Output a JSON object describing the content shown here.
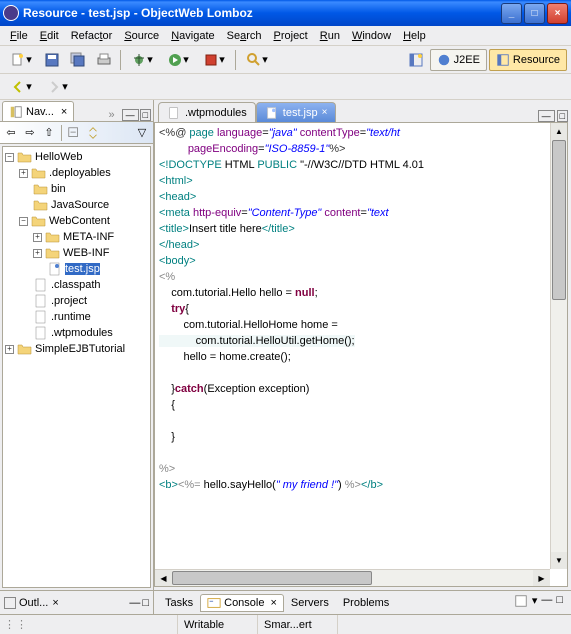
{
  "window": {
    "title": "Resource - test.jsp - ObjectWeb Lomboz"
  },
  "menu": {
    "file": "File",
    "edit": "Edit",
    "refactor": "Refactor",
    "source": "Source",
    "navigate": "Navigate",
    "search": "Search",
    "project": "Project",
    "run": "Run",
    "window": "Window",
    "help": "Help"
  },
  "perspectives": {
    "j2ee": "J2EE",
    "resource": "Resource"
  },
  "navigator": {
    "title": "Nav..."
  },
  "tree": {
    "n0": "HelloWeb",
    "n1": ".deployables",
    "n2": "bin",
    "n3": "JavaSource",
    "n4": "WebContent",
    "n5": "META-INF",
    "n6": "WEB-INF",
    "n7": "test.jsp",
    "n8": ".classpath",
    "n9": ".project",
    "n10": ".runtime",
    "n11": ".wtpmodules",
    "n12": "SimpleEJBTutorial"
  },
  "editor_tabs": {
    "wtp": ".wtpmodules",
    "test": "test.jsp"
  },
  "code": {
    "l1a": "<%@",
    "l1b": " page ",
    "l1c": "language",
    "l1d": "=",
    "l1e": "\"java\"",
    "l1f": " ",
    "l1g": "contentType",
    "l1h": "=",
    "l1i": "\"text/ht",
    "l2a": "pageEncoding",
    "l2b": "=",
    "l2c": "\"ISO-8859-1\"",
    "l2d": "%>",
    "l3a": "<!DOCTYPE",
    "l3b": " HTML ",
    "l3c": "PUBLIC",
    "l3d": " \"-//W3C//DTD HTML 4.01",
    "l4a": "<html>",
    "l5a": "<head>",
    "l6a": "<meta",
    "l6b": " ",
    "l6c": "http-equiv",
    "l6d": "=",
    "l6e": "\"Content-Type\"",
    "l6f": " ",
    "l6g": "content",
    "l6h": "=",
    "l6i": "\"text",
    "l7a": "<title>",
    "l7b": "Insert title here",
    "l7c": "</title>",
    "l8a": "</head>",
    "l9a": "<body>",
    "l10a": "<%",
    "l11a": "    com.tutorial.Hello hello = ",
    "l11b": "null",
    "l11c": ";",
    "l12a": "    ",
    "l12b": "try",
    "l12c": "{",
    "l13a": "        com.tutorial.HelloHome home = ",
    "l14a": "            com.tutorial.HelloUtil.getHome();",
    "l15a": "        hello = home.create();",
    "l16a": "",
    "l17a": "    }",
    "l17b": "catch",
    "l17c": "(Exception exception)",
    "l18a": "    {",
    "l19a": "",
    "l20a": "    }",
    "l21a": "",
    "l22a": "%>",
    "l23a": "<b>",
    "l23b": "<%=",
    "l23c": " hello.sayHello(",
    "l23d": "\" my friend !\"",
    "l23e": ") ",
    "l23f": "%>",
    "l23g": "</b>"
  },
  "outline": {
    "title": "Outl..."
  },
  "bottom_views": {
    "tasks": "Tasks",
    "console": "Console",
    "servers": "Servers",
    "problems": "Problems"
  },
  "status": {
    "writable": "Writable",
    "smart": "Smar...ert"
  }
}
